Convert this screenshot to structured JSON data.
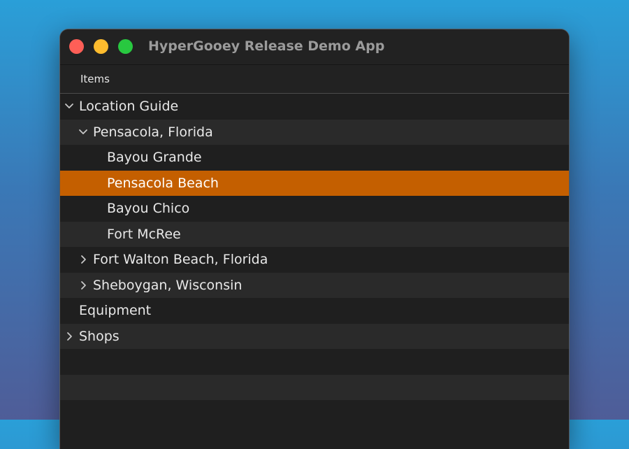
{
  "window": {
    "title": "HyperGooey Release Demo App"
  },
  "traffic_lights": {
    "close_color": "#fe5f57",
    "minimize_color": "#febc2e",
    "zoom_color": "#28c840"
  },
  "outline": {
    "column_header": "Items",
    "rows": [
      {
        "label": "Location Guide",
        "level": 0,
        "disclosure": "expanded"
      },
      {
        "label": "Pensacola, Florida",
        "level": 1,
        "disclosure": "expanded"
      },
      {
        "label": "Bayou Grande",
        "level": 2,
        "disclosure": "none"
      },
      {
        "label": "Pensacola Beach",
        "level": 2,
        "disclosure": "none",
        "selected": true
      },
      {
        "label": "Bayou Chico",
        "level": 2,
        "disclosure": "none"
      },
      {
        "label": "Fort McRee",
        "level": 2,
        "disclosure": "none"
      },
      {
        "label": "Fort Walton Beach, Florida",
        "level": 1,
        "disclosure": "collapsed"
      },
      {
        "label": "Sheboygan, Wisconsin",
        "level": 1,
        "disclosure": "collapsed"
      },
      {
        "label": "Equipment",
        "level": 0,
        "disclosure": "none"
      },
      {
        "label": "Shops",
        "level": 0,
        "disclosure": "collapsed"
      },
      {
        "label": "",
        "level": 0,
        "disclosure": "none"
      },
      {
        "label": "",
        "level": 0,
        "disclosure": "none"
      },
      {
        "label": "",
        "level": 0,
        "disclosure": "none"
      }
    ],
    "selection_color": "#c45f00",
    "chevron_icons": {
      "expanded": "chevron-down-icon",
      "collapsed": "chevron-right-icon"
    }
  }
}
